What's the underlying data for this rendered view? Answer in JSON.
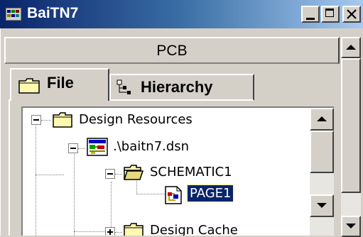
{
  "window": {
    "title": "BaiTN7"
  },
  "header": {
    "title": "PCB"
  },
  "tabs": [
    {
      "label": "File",
      "icon": "folder-icon",
      "selected": true
    },
    {
      "label": "Hierarchy",
      "icon": "hierarchy-icon",
      "selected": false
    }
  ],
  "tree": {
    "nodes": [
      {
        "label": "Design Resources",
        "icon": "folder-icon",
        "expanded": true
      },
      {
        "label": ".\\baitn7.dsn",
        "icon": "design-file-icon",
        "expanded": true
      },
      {
        "label": "SCHEMATIC1",
        "icon": "open-folder-icon",
        "expanded": true
      },
      {
        "label": "PAGE1",
        "icon": "page-icon",
        "selected": true
      },
      {
        "label": "Design Cache",
        "icon": "folder-icon",
        "expanded": false
      }
    ]
  },
  "colors": {
    "titlebar_start": "#0a246a",
    "titlebar_end": "#a6caf0",
    "selection": "#0a246a",
    "face": "#d4d0c8"
  }
}
